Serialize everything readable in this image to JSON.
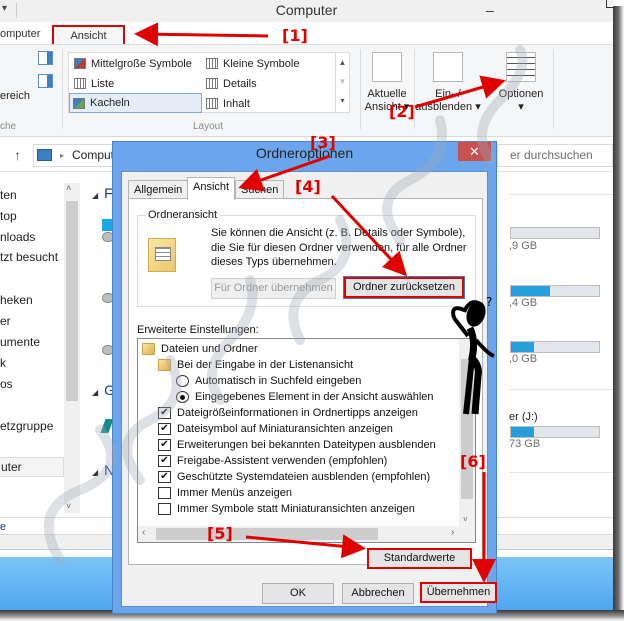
{
  "explorer": {
    "title": "Computer",
    "qat_glyph": "▾",
    "ribbon_tabs": [
      {
        "label": "omputer"
      },
      {
        "label": "Ansicht",
        "active": true
      }
    ],
    "panes_group": {
      "partial_label": "ereich",
      "group_label": "che"
    },
    "layout_group": {
      "items": [
        {
          "label": "Mittelgroße Symbole"
        },
        {
          "label": "Kleine Symbole"
        },
        {
          "label": "Liste"
        },
        {
          "label": "Details"
        },
        {
          "label": "Kacheln",
          "selected": true
        },
        {
          "label": "Inhalt"
        }
      ],
      "scroll_up": "▲",
      "scroll_down": "▼",
      "scroll_more": "▾",
      "group_label": "Layout"
    },
    "ribbon_buttons": [
      {
        "label_line1": "Aktuelle",
        "label_line2": "Ansicht ▾"
      },
      {
        "label_line1": "Ein- /",
        "label_line2": "ausblenden ▾"
      },
      {
        "label_line1": "Optionen",
        "label_line2": "▾"
      }
    ],
    "address": {
      "up_glyph": "↑",
      "chevron": "▸",
      "path": "Computer",
      "search_placeholder": "er durchsuchen"
    },
    "nav_items": [
      {
        "label": "ten"
      },
      {
        "label": "top"
      },
      {
        "label": "nloads"
      },
      {
        "label": "tzt besucht"
      },
      {
        "label": "heken"
      },
      {
        "label": "er"
      },
      {
        "label": "umente"
      },
      {
        "label": "k"
      },
      {
        "label": "os"
      },
      {
        "label": "etzgruppe"
      },
      {
        "label": "uter",
        "selected": true
      }
    ],
    "nav_scroll": {
      "up": "˄",
      "down": "˅"
    },
    "sections": [
      {
        "initial": "F"
      },
      {
        "initial": "G"
      },
      {
        "initial": "N"
      }
    ],
    "drives": [
      {
        "name": "",
        "capacity_text": ",9 GB",
        "used_fraction": 0.0
      },
      {
        "name": "",
        "capacity_text": ",4 GB",
        "used_fraction": 0.44
      },
      {
        "name": "",
        "capacity_text": ",0 GB",
        "used_fraction": 0.26
      },
      {
        "name": "er (J:)",
        "capacity_text": "73 GB",
        "used_fraction": 0.26
      }
    ],
    "status_text": "e",
    "accent_color": "#26a0da"
  },
  "dialog": {
    "title": "Ordneroptionen",
    "close_glyph": "✕",
    "tabs": [
      {
        "label": "Allgemein"
      },
      {
        "label": "Ansicht",
        "active": true
      },
      {
        "label": "Suchen"
      }
    ],
    "folder_view": {
      "legend": "Ordneransicht",
      "description": "Sie können die Ansicht (z. B. Details oder Symbole), die Sie für diesen Ordner verwenden, für alle Ordner dieses Typs übernehmen.",
      "apply_button": "Für Ordner übernehmen",
      "reset_button": "Ordner zurücksetzen"
    },
    "advanced_label": "Erweiterte Einstellungen:",
    "advanced_items": [
      {
        "type": "folder",
        "level": 0,
        "label": "Dateien und Ordner"
      },
      {
        "type": "folder",
        "level": 1,
        "label": "Bei der Eingabe in der Listenansicht"
      },
      {
        "type": "radio",
        "level": 2,
        "label": "Automatisch in Suchfeld eingeben",
        "checked": false
      },
      {
        "type": "radio",
        "level": 2,
        "label": "Eingegebenes Element in der Ansicht auswählen",
        "checked": true
      },
      {
        "type": "checkbox",
        "level": 1,
        "label": "Dateigrößeinformationen in Ordnertipps anzeigen",
        "checked": true
      },
      {
        "type": "checkbox",
        "level": 1,
        "label": "Dateisymbol auf Miniaturansichten anzeigen",
        "checked": true
      },
      {
        "type": "checkbox",
        "level": 1,
        "label": "Erweiterungen bei bekannten Dateitypen ausblenden",
        "checked": true
      },
      {
        "type": "checkbox",
        "level": 1,
        "label": "Freigabe-Assistent verwenden (empfohlen)",
        "checked": true
      },
      {
        "type": "checkbox",
        "level": 1,
        "label": "Geschützte Systemdateien ausblenden (empfohlen)",
        "checked": true
      },
      {
        "type": "checkbox",
        "level": 1,
        "label": "Immer Menüs anzeigen",
        "checked": false
      },
      {
        "type": "checkbox",
        "level": 1,
        "label": "Immer Symbole statt Miniaturansichten anzeigen",
        "checked": false
      }
    ],
    "check_glyph": "✔",
    "scroll": {
      "down": "˅",
      "left": "‹",
      "right": "›"
    },
    "defaults_button": "Standardwerte",
    "ok_button": "OK",
    "cancel_button": "Abbrechen",
    "apply_button": "Übernehmen"
  },
  "annotations": [
    {
      "label": "[1]"
    },
    {
      "label": "[2]"
    },
    {
      "label": "[3]"
    },
    {
      "label": "[4]"
    },
    {
      "label": "[5]"
    },
    {
      "label": "[6]"
    }
  ],
  "annotation_color": "#e00000"
}
